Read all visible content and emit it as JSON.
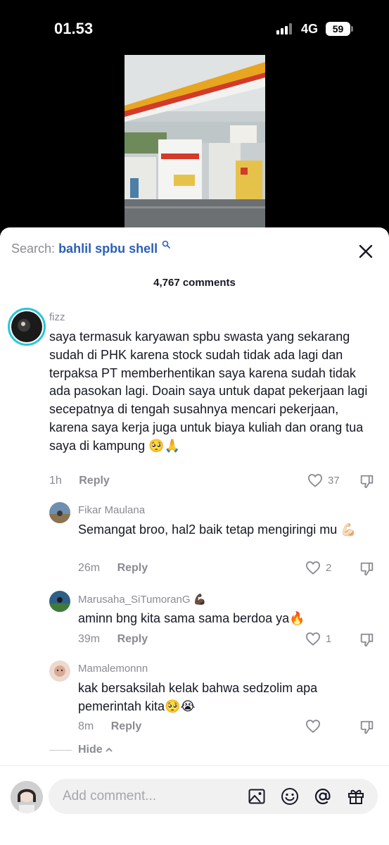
{
  "status_bar": {
    "time": "01.53",
    "network": "4G",
    "battery": "59"
  },
  "search": {
    "label": "Search:",
    "query": "bahlil spbu shell"
  },
  "comment_count": "4,767 comments",
  "comments": [
    {
      "username": "fizz",
      "text": "saya termasuk karyawan spbu swasta yang sekarang sudah di PHK karena stock sudah tidak ada lagi dan terpaksa PT memberhentikan saya karena sudah tidak ada pasokan lagi. Doain saya untuk dapat pekerjaan lagi secepatnya di tengah susahnya mencari pekerjaan, karena saya kerja juga untuk biaya kuliah dan orang tua saya di kampung",
      "emoji": "🥺🙏",
      "time": "1h",
      "reply_label": "Reply",
      "likes": "37"
    }
  ],
  "replies": [
    {
      "username": "Fikar Maulana",
      "text": "Semangat broo, hal2 baik tetap mengiringi mu",
      "emoji": "💪🏻",
      "time": "26m",
      "reply_label": "Reply",
      "likes": "2"
    },
    {
      "username": "Marusaha_SiTumoranG",
      "username_emoji": "💪🏿",
      "text": "aminn bng kita sama sama berdoa ya",
      "emoji": "🔥",
      "time": "39m",
      "reply_label": "Reply",
      "likes": "1"
    },
    {
      "username": "Mamalemonnn",
      "text": "kak bersaksilah kelak bahwa sedzolim apa pemerintah kita",
      "emoji": "🥺😭",
      "time": "8m",
      "reply_label": "Reply",
      "likes": ""
    }
  ],
  "hide_label": "Hide",
  "composer": {
    "placeholder": "Add comment..."
  },
  "icons": [
    "search-icon",
    "close-icon",
    "heart-icon",
    "dislike-icon",
    "image-icon",
    "emoji-icon",
    "mention-icon",
    "gift-icon"
  ],
  "colors": {
    "accent_link": "#2b5fb5",
    "text": "#161823",
    "muted": "#8a8b91"
  }
}
